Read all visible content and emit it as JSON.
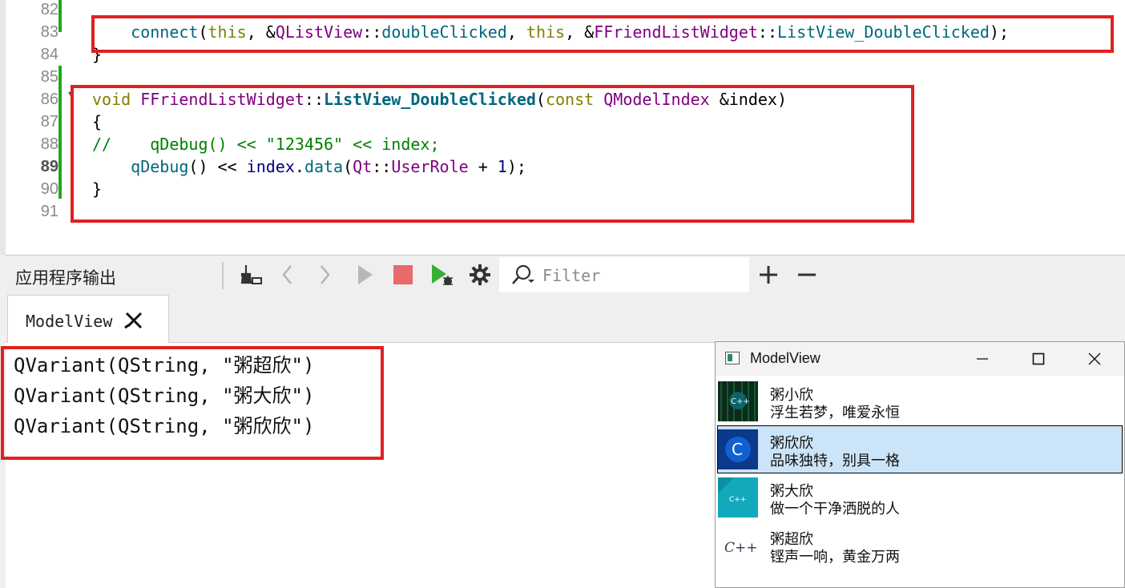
{
  "editor": {
    "line_numbers": [
      "82",
      "83",
      "84",
      "85",
      "86",
      "87",
      "88",
      "89",
      "90",
      "91"
    ],
    "current_line": "89",
    "line83": {
      "indent": "    ",
      "fn": "connect",
      "p1": "(",
      "this1": "this",
      "p2": ", &",
      "cls1": "QListView",
      "p3": "::",
      "sig": "doubleClicked",
      "p4": ", ",
      "this2": "this",
      "p5": ", &",
      "cls2": "FFriendListWidget",
      "p6": "::",
      "slot": "ListView_DoubleClicked",
      "p7": ");"
    },
    "line84": "}",
    "line86": {
      "kw_void": "void",
      "cls": "FFriendListWidget",
      "sep": "::",
      "method": "ListView_DoubleClicked",
      "p1": "(",
      "kw_const": "const",
      "sp": " ",
      "type": "QModelIndex",
      "param": " &index)"
    },
    "line87": "{",
    "line88": {
      "comment_prefix": "//    ",
      "call": "qDebug() << ",
      "str": "\"123456\"",
      "rest": " << index;"
    },
    "line89": {
      "indent": "    ",
      "fn": "qDebug",
      "p1": "() << ",
      "var": "index",
      "dot": ".",
      "method": "data",
      "p2": "(",
      "ns": "Qt",
      "sep": "::",
      "role": "UserRole",
      "plus": " + ",
      "num": "1",
      "p3": ");"
    },
    "line90": "}"
  },
  "output_toolbar": {
    "title": "应用程序输出",
    "filter_placeholder": "Filter",
    "icons": [
      "clean-icon",
      "prev-icon",
      "next-icon",
      "run-icon",
      "stop-icon",
      "debug-icon",
      "settings-icon",
      "add-icon",
      "remove-icon"
    ]
  },
  "tabs": [
    {
      "label": "ModelView",
      "closable": true
    }
  ],
  "output_lines": [
    "QVariant(QString, \"粥超欣\")",
    "QVariant(QString, \"粥大欣\")",
    "QVariant(QString, \"粥欣欣\")"
  ],
  "modelview_window": {
    "title": "ModelView",
    "items": [
      {
        "name": "粥小欣",
        "desc": "浮生若梦，唯爱永恒",
        "thumb_text": "C++",
        "selected": false
      },
      {
        "name": "粥欣欣",
        "desc": "品味独特，别具一格",
        "thumb_text": "C",
        "selected": true
      },
      {
        "name": "粥大欣",
        "desc": "做一个干净洒脱的人",
        "thumb_text": "C++",
        "selected": false
      },
      {
        "name": "粥超欣",
        "desc": "铿声一响，黄金万两",
        "thumb_text": "C++",
        "selected": false
      }
    ]
  },
  "colors": {
    "highlight_box": "#e02020",
    "selection": "#cce4f7",
    "modified_marker": "#1da81d"
  }
}
